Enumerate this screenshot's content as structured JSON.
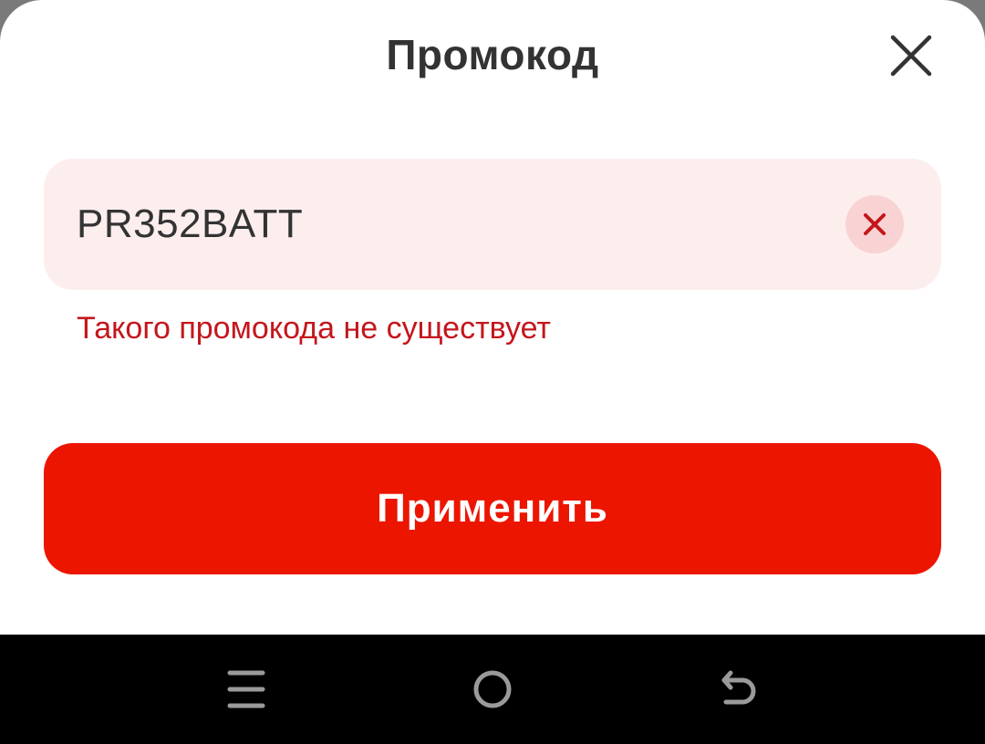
{
  "sheet": {
    "title": "Промокод",
    "close_icon": "close-icon"
  },
  "promo": {
    "value": "PR352BATT",
    "clear_icon": "clear-x-icon",
    "error": "Такого промокода не существует"
  },
  "apply_button": {
    "label": "Применить"
  },
  "navigation": {
    "menu_icon": "menu-lines-icon",
    "home_icon": "home-circle-icon",
    "back_icon": "back-arrow-icon"
  },
  "colors": {
    "accent": "#ec1500",
    "error": "#c4161c",
    "field_background": "#fdeeee",
    "clear_button_background": "#f9d3d3"
  }
}
